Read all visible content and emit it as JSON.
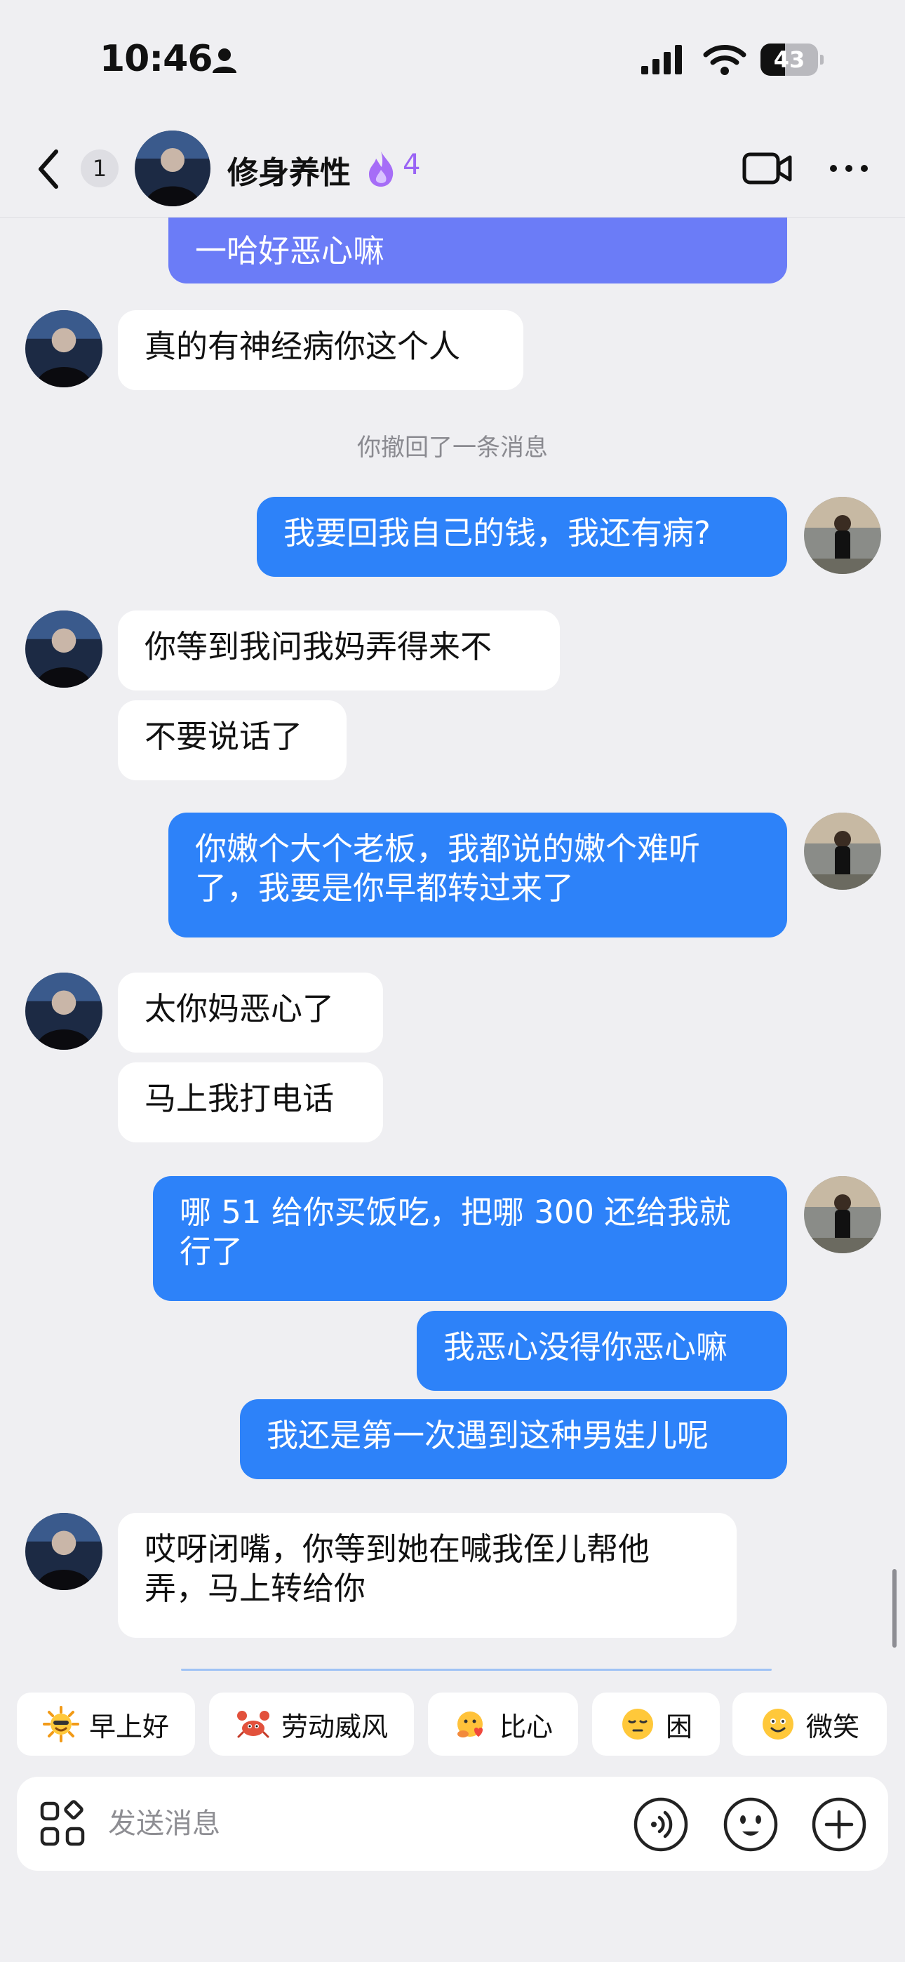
{
  "status_bar": {
    "time": "10:46",
    "battery": "43",
    "battery_level": 0.43
  },
  "header": {
    "unread_count": "1",
    "contact_name": "修身养性",
    "streak_count": "4"
  },
  "messages": [
    {
      "side": "out",
      "text": "一哈好恶心嘛"
    },
    {
      "side": "in",
      "text": "真的有神经病你这个人"
    },
    {
      "side": "system",
      "text": "你撤回了一条消息"
    },
    {
      "side": "out",
      "text": "我要回我自己的钱，我还有病?"
    },
    {
      "side": "in",
      "text": "你等到我问我妈弄得来不"
    },
    {
      "side": "in",
      "text": "不要说话了"
    },
    {
      "side": "out",
      "lines": [
        "你嫩个大个老板，我都说的嫩个难听",
        "了，我要是你早都转过来了"
      ]
    },
    {
      "side": "in",
      "text": "太你妈恶心了"
    },
    {
      "side": "in",
      "text": "马上我打电话"
    },
    {
      "side": "out",
      "lines": [
        "哪 51 给你买饭吃，把哪 300 还给我就",
        "行了"
      ]
    },
    {
      "side": "out",
      "text": "我恶心没得你恶心嘛"
    },
    {
      "side": "out",
      "text": "我还是第一次遇到这种男娃儿呢"
    },
    {
      "side": "in",
      "lines": [
        "哎呀闭嘴，你等到她在喊我侄儿帮他",
        "弄，马上转给你"
      ]
    }
  ],
  "quick_replies": [
    {
      "label": "早上好",
      "icon": "sun-face-icon"
    },
    {
      "label": "劳动威风",
      "icon": "crab-icon"
    },
    {
      "label": "比心",
      "icon": "heart-hands-icon"
    },
    {
      "label": "困",
      "icon": "sleepy-face-icon"
    },
    {
      "label": "微笑",
      "icon": "smile-face-icon"
    }
  ],
  "composer": {
    "placeholder": "发送消息"
  },
  "colors": {
    "outgoing_bubble": "#2d82f9",
    "incoming_bubble": "#ffffff",
    "background": "#efeff2",
    "streak_purple": "#9a64f5"
  }
}
